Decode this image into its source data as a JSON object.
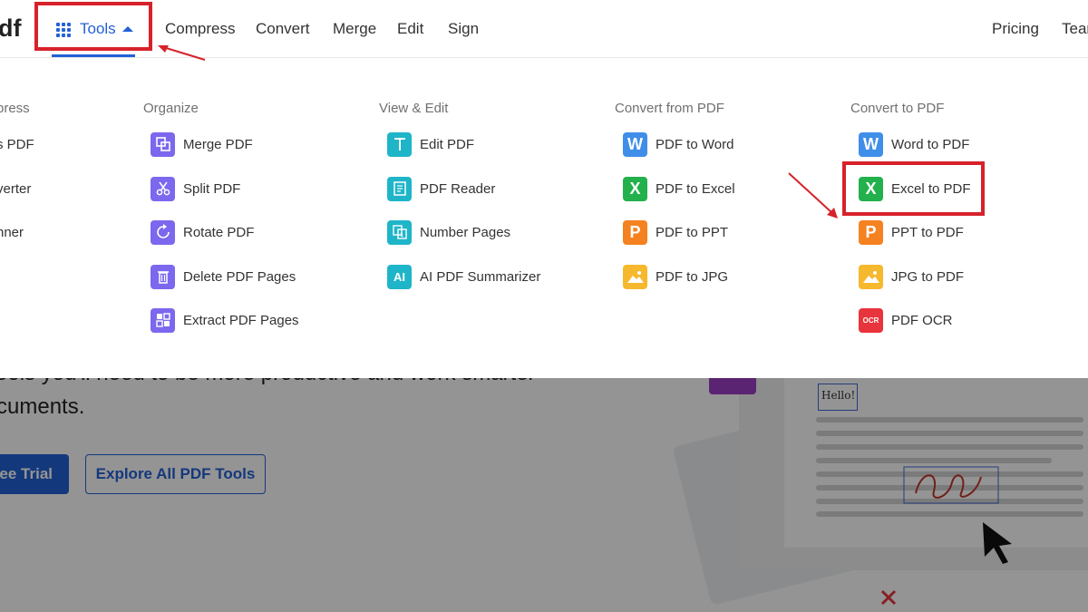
{
  "header": {
    "logo_text": "df",
    "tools_label": "Tools",
    "nav": [
      "Compress",
      "Convert",
      "Merge",
      "Edit",
      "Sign"
    ],
    "pricing": "Pricing",
    "team": "Tean"
  },
  "dropdown": {
    "partial_column": {
      "title": "press",
      "items": [
        "s PDF",
        "verter",
        "nner"
      ]
    },
    "organize": {
      "title": "Organize",
      "items": [
        {
          "label": "Merge PDF",
          "icon": "merge-icon",
          "color": "#7b68ee"
        },
        {
          "label": "Split PDF",
          "icon": "scissors-icon",
          "color": "#7b68ee"
        },
        {
          "label": "Rotate PDF",
          "icon": "rotate-icon",
          "color": "#7b68ee"
        },
        {
          "label": "Delete PDF Pages",
          "icon": "trash-icon",
          "color": "#7b68ee"
        },
        {
          "label": "Extract PDF Pages",
          "icon": "extract-icon",
          "color": "#7b68ee"
        }
      ]
    },
    "view_edit": {
      "title": "View & Edit",
      "items": [
        {
          "label": "Edit PDF",
          "icon": "text-t-icon",
          "color": "#1fb5c9"
        },
        {
          "label": "PDF Reader",
          "icon": "reader-icon",
          "color": "#1fb5c9"
        },
        {
          "label": "Number Pages",
          "icon": "number-pages-icon",
          "color": "#1fb5c9"
        },
        {
          "label": "AI PDF Summarizer",
          "icon": "ai-icon",
          "glyph": "AI",
          "color": "#1fb5c9"
        }
      ]
    },
    "convert_from": {
      "title": "Convert from PDF",
      "items": [
        {
          "label": "PDF to Word",
          "icon": "word-icon",
          "glyph": "W",
          "color": "#3f8ee8"
        },
        {
          "label": "PDF to Excel",
          "icon": "excel-icon",
          "glyph": "X",
          "color": "#22b14c"
        },
        {
          "label": "PDF to PPT",
          "icon": "ppt-icon",
          "glyph": "P",
          "color": "#f58220"
        },
        {
          "label": "PDF to JPG",
          "icon": "jpg-icon",
          "color": "#f6b82d"
        }
      ]
    },
    "convert_to": {
      "title": "Convert to PDF",
      "items": [
        {
          "label": "Word to PDF",
          "icon": "word-icon",
          "glyph": "W",
          "color": "#3f8ee8"
        },
        {
          "label": "Excel to PDF",
          "icon": "excel-icon",
          "glyph": "X",
          "color": "#22b14c"
        },
        {
          "label": "PPT to PDF",
          "icon": "ppt-icon",
          "glyph": "P",
          "color": "#f58220"
        },
        {
          "label": "JPG to PDF",
          "icon": "jpg-icon",
          "color": "#f6b82d"
        },
        {
          "label": "PDF OCR",
          "icon": "ocr-icon",
          "glyph": "OCR",
          "color": "#e8343c"
        }
      ]
    }
  },
  "hero": {
    "line1": "ools you'll need to be more productive and work smarter",
    "line2": "cuments.",
    "trial_button": "ree Trial",
    "explore_button": "Explore All PDF Tools",
    "hello_text": "Hello!"
  },
  "colors": {
    "accent": "#2361d6",
    "highlight": "#d7222a"
  }
}
